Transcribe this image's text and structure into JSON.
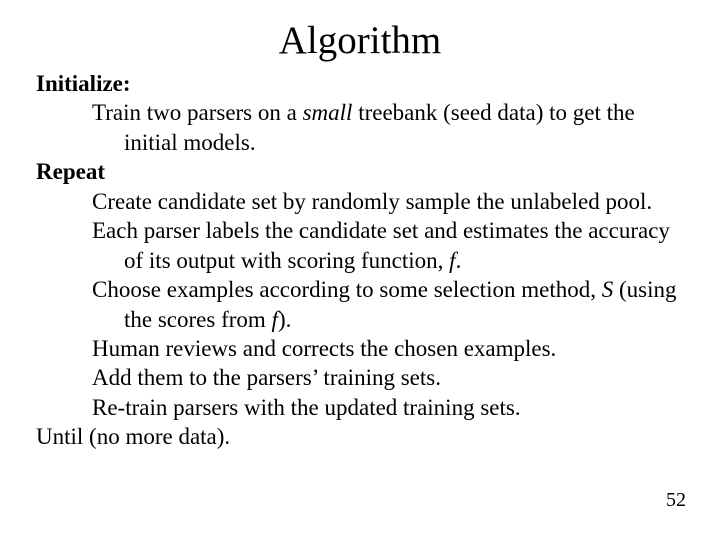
{
  "title": "Algorithm",
  "initialize_label": "Initialize:",
  "initialize_step_pre": "Train two parsers on a ",
  "initialize_step_em": "small",
  "initialize_step_post": " treebank (seed data)  to get the initial models.",
  "repeat_label": "Repeat",
  "repeat_steps": {
    "s1": "Create candidate set by randomly sample the unlabeled pool.",
    "s2_pre": "Each parser labels the candidate set and estimates the accuracy of its output with scoring function, ",
    "s2_em": "f",
    "s2_post": ".",
    "s3_pre": "Choose examples according to some selection method, ",
    "s3_em1": "S",
    "s3_mid": " (using the scores from ",
    "s3_em2": "f",
    "s3_post": ").",
    "s4": "Human reviews and corrects the chosen examples.",
    "s5": "Add them to the parsers’ training sets.",
    "s6": "Re-train parsers with the updated training sets."
  },
  "until_label": "Until (no more data).",
  "page_number": "52"
}
